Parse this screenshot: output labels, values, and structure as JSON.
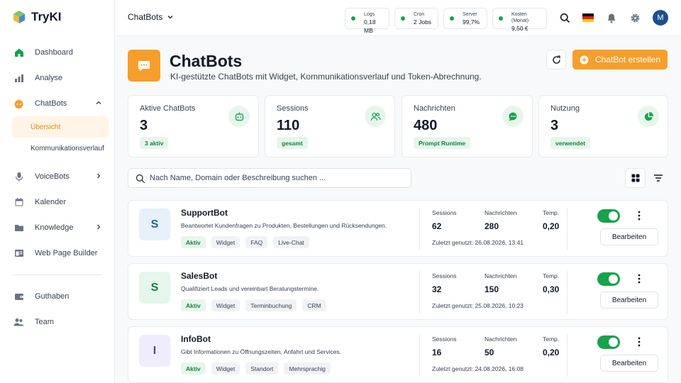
{
  "app": {
    "name": "TryKI"
  },
  "sidebar": {
    "items": [
      {
        "label": "Dashboard",
        "icon": "home-icon"
      },
      {
        "label": "Analyse",
        "icon": "bar-chart-icon"
      },
      {
        "label": "ChatBots",
        "icon": "chatbot-icon",
        "expanded": true,
        "children": [
          {
            "label": "Übersicht",
            "active": true
          },
          {
            "label": "Kommunikationsverlauf"
          }
        ]
      },
      {
        "label": "VoiceBots",
        "icon": "microphone-icon"
      },
      {
        "label": "Kalender",
        "icon": "calendar-icon"
      },
      {
        "label": "Knowledge",
        "icon": "folder-icon"
      },
      {
        "label": "Web Page Builder",
        "icon": "browser-icon"
      },
      {
        "label": "Guthaben",
        "icon": "wallet-icon"
      },
      {
        "label": "Team",
        "icon": "team-icon"
      }
    ]
  },
  "topbar": {
    "workspace": "ChatBots",
    "stats": [
      {
        "label": "Logs",
        "value": "0,18 MB"
      },
      {
        "label": "Cron",
        "value": "2 Jobs"
      },
      {
        "label": "Server",
        "value": "99,7%"
      },
      {
        "label": "Kosten (Monat)",
        "value": "9,50 €"
      }
    ],
    "avatar": "M"
  },
  "header": {
    "title": "ChatBots",
    "subtitle": "KI-gestützte ChatBots mit Widget, Kommunikationsverlauf und Token-Abrechnung.",
    "create_label": "ChatBot erstellen"
  },
  "cards": [
    {
      "label": "Aktive ChatBots",
      "value": "3",
      "badge": "3 aktiv",
      "icon": "robot-icon"
    },
    {
      "label": "Sessions",
      "value": "110",
      "badge": "gesamt",
      "icon": "users-icon"
    },
    {
      "label": "Nachrichten",
      "value": "480",
      "badge": "Prompt Runtime",
      "icon": "message-icon"
    },
    {
      "label": "Nutzung",
      "value": "3",
      "badge": "verwendet",
      "icon": "pie-chart-icon"
    }
  ],
  "search": {
    "placeholder": "Nach Name, Domain oder Beschreibung suchen ..."
  },
  "metric_labels": {
    "sessions": "Sessions",
    "messages": "Nachrichten",
    "temp": "Temp."
  },
  "last_used_prefix": "Zuletzt genutzt:",
  "edit_label": "Bearbeiten",
  "bots": [
    {
      "initial": "S",
      "name": "SupportBot",
      "description": "Beantwortet Kundenfragen zu Produkten, Bestellungen und Rücksendungen.",
      "tags": [
        "Aktiv",
        "Widget",
        "FAQ",
        "Live-Chat"
      ],
      "sessions": "62",
      "messages": "280",
      "temp": "0,20",
      "last_used": "26.08.2026, 13:41",
      "enabled": true,
      "avatar_bg": "#e6f1fb",
      "avatar_fg": "#1d5fa6"
    },
    {
      "initial": "S",
      "name": "SalesBot",
      "description": "Qualifiziert Leads und vereinbart Beratungstermine.",
      "tags": [
        "Aktiv",
        "Widget",
        "Terminbuchung",
        "CRM"
      ],
      "sessions": "32",
      "messages": "150",
      "temp": "0,30",
      "last_used": "25.08.2026, 10:23",
      "enabled": true,
      "avatar_bg": "#e5f6ec",
      "avatar_fg": "#15803d"
    },
    {
      "initial": "I",
      "name": "InfoBot",
      "description": "Gibt Informationen zu Öffnungszeiten, Anfahrt und Services.",
      "tags": [
        "Aktiv",
        "Widget",
        "Standort",
        "Mehrsprachig"
      ],
      "sessions": "16",
      "messages": "50",
      "temp": "0,20",
      "last_used": "24.08.2026, 16:08",
      "enabled": true,
      "avatar_bg": "#efecfb",
      "avatar_fg": "#5b3fa8"
    }
  ],
  "colors": {
    "accent": "#f59e2c",
    "success": "#16a34a",
    "avatar": "#1e4d8c"
  }
}
